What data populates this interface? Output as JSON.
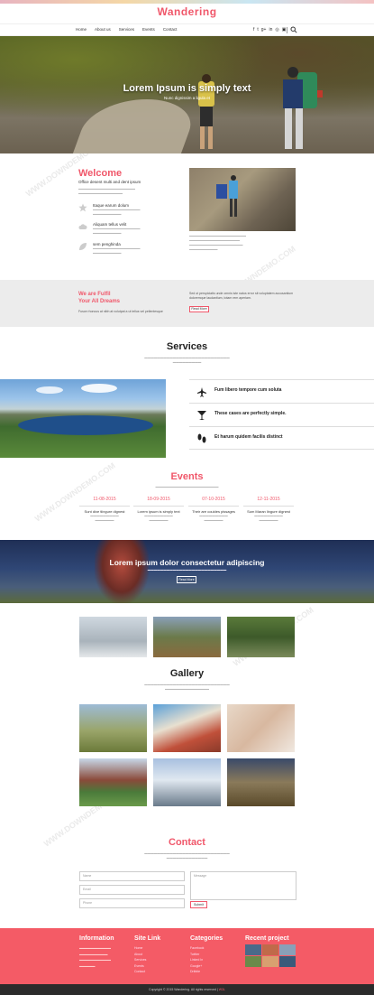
{
  "brand": "Wandering",
  "nav": {
    "links": [
      "Home",
      "About us",
      "Services",
      "Events",
      "Contact"
    ],
    "social_icons": [
      "facebook-icon",
      "twitter-icon",
      "google-plus-icon",
      "linkedin-icon",
      "dribbble-icon",
      "instagram-icon"
    ]
  },
  "hero": {
    "title": "Lorem Ipsum is simply text",
    "subtitle": "Nunc dignissim a ligula et"
  },
  "welcome": {
    "title": "Welcome",
    "subtitle": "Office desent multi and dent ipsum",
    "features": [
      {
        "icon": "star-icon",
        "title": "Itaque earum dolum"
      },
      {
        "icon": "cloud-icon",
        "title": "Aliquam tellus velit"
      },
      {
        "icon": "leaf-icon",
        "title": "sem penghinda"
      }
    ]
  },
  "band": {
    "title_line1": "We are Fulfil",
    "title_line2": "Your All Dreams",
    "subtitle": "Fusce rhoncus at nibh at volutpat a ut tellus vel pellentesque",
    "text": "Sed ut perspiciatis unde omnis iste natus error sit voluptatem accusantium doloremque laudantium, totam rem aperiam.",
    "button": "Read More"
  },
  "services": {
    "title": "Services",
    "items": [
      {
        "icon": "plane-icon",
        "label": "Fum libero tempore cum soluta"
      },
      {
        "icon": "cocktail-icon",
        "label": "These cases are perfectly simple."
      },
      {
        "icon": "footprints-icon",
        "label": "Et harum quidem facilis distinct"
      }
    ]
  },
  "events": {
    "title": "Events",
    "items": [
      {
        "date": "11-08-2015",
        "title": "Sunt dixe tlingure dignest"
      },
      {
        "date": "18-09-2015",
        "title": "Lorem ipsum is simply text"
      },
      {
        "date": "07-10-2015",
        "title": "Their are couldes pissages"
      },
      {
        "date": "12-11-2015",
        "title": "Sum Maran lingure dignest"
      }
    ]
  },
  "banner": {
    "title": "Lorem ipsum dolor consectetur adipiscing",
    "button": "Read More"
  },
  "gallery": {
    "title": "Gallery"
  },
  "contact": {
    "title": "Contact",
    "name_placeholder": "Name",
    "email_placeholder": "Email",
    "phone_placeholder": "Phone",
    "message_placeholder": "Message",
    "submit": "Submit"
  },
  "footer": {
    "information": {
      "title": "Information"
    },
    "site_link": {
      "title": "Site Link",
      "items": [
        "Home",
        "About",
        "Services",
        "Events",
        "Contact"
      ]
    },
    "categories": {
      "title": "Categories",
      "items": [
        "Facebook",
        "Twitter",
        "Linked In",
        "Google+",
        "Dribble"
      ]
    },
    "recent": {
      "title": "Recent project"
    },
    "copyright_prefix": "Copyright © 2015 Wandering. All rights reserved |",
    "copyright_link": "W3L"
  },
  "colors": {
    "accent": "#f0576a",
    "footer": "#f45b66",
    "copyright_bg": "#2b2b2b"
  }
}
